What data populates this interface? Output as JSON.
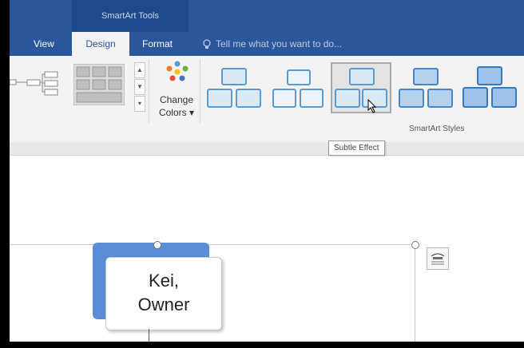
{
  "contextual": {
    "label": "SmartArt Tools"
  },
  "tabs": {
    "view": "View",
    "design": "Design",
    "format": "Format"
  },
  "tell_me": {
    "text": "Tell me what you want to do..."
  },
  "ribbon": {
    "change_colors": {
      "line1": "Change",
      "line2": "Colors ▾"
    },
    "group_label": "SmartArt Styles",
    "styles_count_visible": 5,
    "selected_style_index": 2
  },
  "tooltip": {
    "text": "Subtle Effect"
  },
  "document": {
    "node_text_line1": "Kei,",
    "node_text_line2": "Owner"
  },
  "colors": {
    "ribbon_blue": "#2b579a",
    "node_blue": "#5b8dd6",
    "thumb_blue": "#5b9bd5"
  }
}
